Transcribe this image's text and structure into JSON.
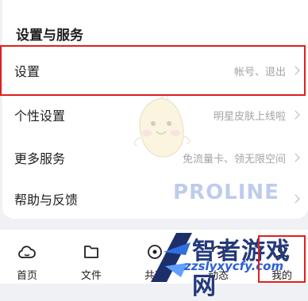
{
  "section": {
    "title": "设置与服务"
  },
  "rows": [
    {
      "label": "设置",
      "hint": "帐号、退出"
    },
    {
      "label": "个性设置",
      "hint": "明星皮肤上线啦"
    },
    {
      "label": "更多服务",
      "hint": "免流量卡、领无限空间"
    },
    {
      "label": "帮助与反馈",
      "hint": ""
    }
  ],
  "tabs": [
    {
      "label": "首页",
      "icon": "cloud-icon"
    },
    {
      "label": "文件",
      "icon": "folder-icon"
    },
    {
      "label": "共享",
      "icon": "share-icon"
    },
    {
      "label": "动态",
      "icon": "activity-icon"
    },
    {
      "label": "我的",
      "icon": "profile-icon"
    }
  ],
  "watermark": {
    "brand": "智者游戏网",
    "url": "zzslyxycfy.com",
    "faint": "PROLINE"
  },
  "colors": {
    "highlight": "#e0201b",
    "hint": "#a3a3a8"
  }
}
